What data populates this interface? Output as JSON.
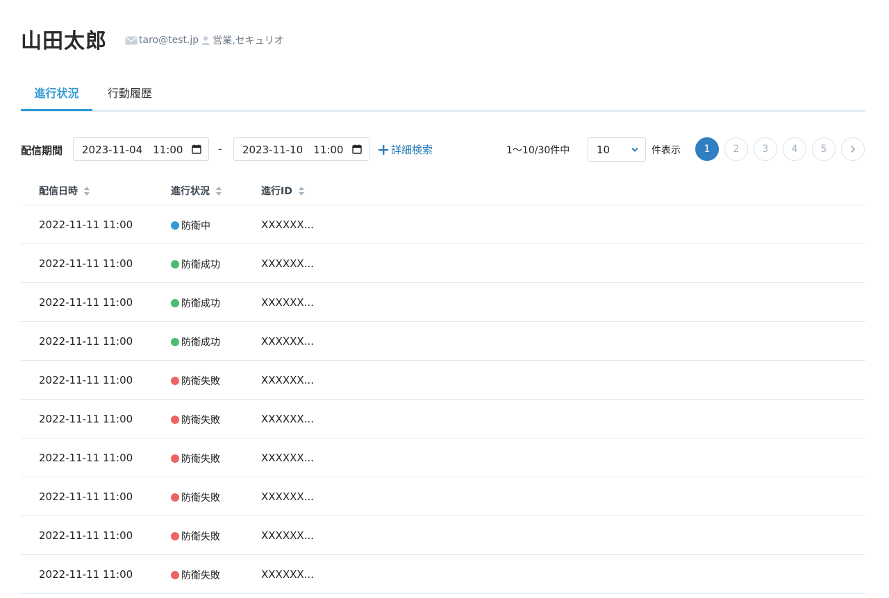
{
  "user": {
    "name": "山田太郎",
    "email": "taro@test.jp",
    "departments": "営業,セキュリオ"
  },
  "tabs": [
    {
      "label": "進行状況",
      "active": true
    },
    {
      "label": "行動履歴",
      "active": false
    }
  ],
  "filter": {
    "label": "配信期間",
    "date_from": "2023-11-04　11:00",
    "separator": "-",
    "date_to": "2023-11-10　11:00",
    "advanced_search": "詳細検索",
    "count_text": "1〜10/30件中",
    "per_page_value": "10",
    "per_page_label": "件表示"
  },
  "pagination": {
    "pages": [
      "1",
      "2",
      "3",
      "4",
      "5"
    ],
    "current": "1"
  },
  "colors": {
    "accent": "#2e9bd6",
    "defending": "#2e9bd6",
    "success": "#4dbb74",
    "failure": "#ee6262",
    "pager_active": "#2f7fc1"
  },
  "table": {
    "headers": [
      "配信日時",
      "進行状況",
      "進行ID"
    ],
    "rows": [
      {
        "date": "2022-11-11 11:00",
        "status": "防衛中",
        "status_color": "#2e9bd6",
        "id": "XXXXXX..."
      },
      {
        "date": "2022-11-11 11:00",
        "status": "防衛成功",
        "status_color": "#4dbb74",
        "id": "XXXXXX..."
      },
      {
        "date": "2022-11-11 11:00",
        "status": "防衛成功",
        "status_color": "#4dbb74",
        "id": "XXXXXX..."
      },
      {
        "date": "2022-11-11 11:00",
        "status": "防衛成功",
        "status_color": "#4dbb74",
        "id": "XXXXXX..."
      },
      {
        "date": "2022-11-11 11:00",
        "status": "防衛失敗",
        "status_color": "#ee6262",
        "id": "XXXXXX..."
      },
      {
        "date": "2022-11-11 11:00",
        "status": "防衛失敗",
        "status_color": "#ee6262",
        "id": "XXXXXX..."
      },
      {
        "date": "2022-11-11 11:00",
        "status": "防衛失敗",
        "status_color": "#ee6262",
        "id": "XXXXXX..."
      },
      {
        "date": "2022-11-11 11:00",
        "status": "防衛失敗",
        "status_color": "#ee6262",
        "id": "XXXXXX..."
      },
      {
        "date": "2022-11-11 11:00",
        "status": "防衛失敗",
        "status_color": "#ee6262",
        "id": "XXXXXX..."
      },
      {
        "date": "2022-11-11 11:00",
        "status": "防衛失敗",
        "status_color": "#ee6262",
        "id": "XXXXXX..."
      }
    ]
  }
}
